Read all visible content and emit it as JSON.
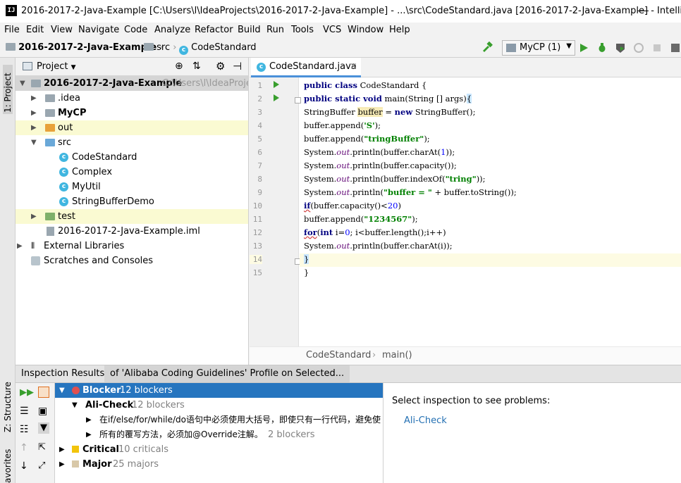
{
  "window": {
    "title": "2016-2017-2-Java-Example [C:\\Users\\l\\IdeaProjects\\2016-2017-2-Java-Example] - ...\\src\\CodeStandard.java [2016-2017-2-Java-Example] - IntelliJ I..."
  },
  "menu": [
    "File",
    "Edit",
    "View",
    "Navigate",
    "Code",
    "Analyze",
    "Refactor",
    "Build",
    "Run",
    "Tools",
    "VCS",
    "Window",
    "Help"
  ],
  "navbar": {
    "project": "2016-2017-2-Java-Example",
    "folder": "src",
    "file": "CodeStandard",
    "run_config": "MyCP (1)"
  },
  "side_tabs": {
    "project": "1: Project",
    "structure": "Z: Structure",
    "favorites": "avorites"
  },
  "project_panel": {
    "title": "Project",
    "tree": [
      {
        "label": "2016-2017-2-Java-Example",
        "extra": "C:\\Users\\l\\IdeaProjec",
        "bold": true
      },
      {
        "label": ".idea"
      },
      {
        "label": "MyCP",
        "bold": true
      },
      {
        "label": "out"
      },
      {
        "label": "src"
      },
      {
        "label": "CodeStandard"
      },
      {
        "label": "Complex"
      },
      {
        "label": "MyUtil"
      },
      {
        "label": "StringBufferDemo"
      },
      {
        "label": "test"
      },
      {
        "label": "2016-2017-2-Java-Example.iml"
      },
      {
        "label": "External Libraries"
      },
      {
        "label": "Scratches and Consoles"
      }
    ]
  },
  "editor": {
    "tab": "CodeStandard.java",
    "line_numbers": [
      "1",
      "2",
      "3",
      "4",
      "5",
      "6",
      "7",
      "8",
      "9",
      "10",
      "11",
      "12",
      "13",
      "14",
      "15"
    ],
    "breadcrumb": [
      "CodeStandard",
      "main()"
    ],
    "code": {
      "l1_kw": "public class",
      "l1_rest": " CodeStandard {",
      "l2_kw": "public static void",
      "l2_rest": " main(String [] args)",
      "l2_brace": "{",
      "l3_a": "StringBuffer ",
      "l3_var": "buffer",
      "l3_b": " = ",
      "l3_kw": "new",
      "l3_c": " StringBuffer();",
      "l4_a": "buffer.append(",
      "l4_str": "'S'",
      "l4_b": ");",
      "l5_a": "buffer.append(",
      "l5_str": "\"tringBuffer\"",
      "l5_b": ");",
      "sys": "System.",
      "out": "out",
      "l6_rest": ".println(buffer.charAt(",
      "l6_num": "1",
      "l6_end": "));",
      "l7_rest": ".println(buffer.capacity());",
      "l8_rest": ".println(buffer.indexOf(",
      "l8_str": "\"tring\"",
      "l8_end": "));",
      "l9_rest": ".println(",
      "l9_str": "\"buffer = \"",
      "l9_end": " + buffer.toString());",
      "l10_kw": "if",
      "l10_a": "(buffer.capacity()<",
      "l10_num": "20",
      "l10_b": ")",
      "l11_a": "buffer.append(",
      "l11_str": "\"1234567\"",
      "l11_b": ");",
      "l12_kw": "for",
      "l12_a": "(",
      "l12_kw2": "int",
      "l12_b": " i=",
      "l12_num": "0",
      "l12_c": "; i<buffer.length();i++)",
      "l13_rest": ".println(buffer.charAt(i));",
      "l14": "}",
      "l15": "}"
    }
  },
  "inspection": {
    "header_label": "Inspection Results:",
    "header_tab": "of 'Alibaba Coding Guidelines' Profile on Selected...",
    "rows": [
      {
        "label": "Blocker",
        "count": "12 blockers"
      },
      {
        "label": "Ali-Check",
        "count": "12 blockers"
      },
      {
        "label": "在if/else/for/while/do语句中必须使用大括号，即使只有一行代码，避免使",
        "count": ""
      },
      {
        "label": "所有的覆写方法，必须加@Override注解。",
        "count": "2 blockers"
      },
      {
        "label": "Critical",
        "count": "10 criticals"
      },
      {
        "label": "Major",
        "count": "25 majors"
      }
    ],
    "detail_text": "Select inspection to see problems:",
    "detail_link": "Ali-Check",
    "colors": {
      "selection": "#2675bf",
      "critical": "#f2c40c",
      "major": "#d8c8a8",
      "blocker": "#e05050"
    }
  }
}
